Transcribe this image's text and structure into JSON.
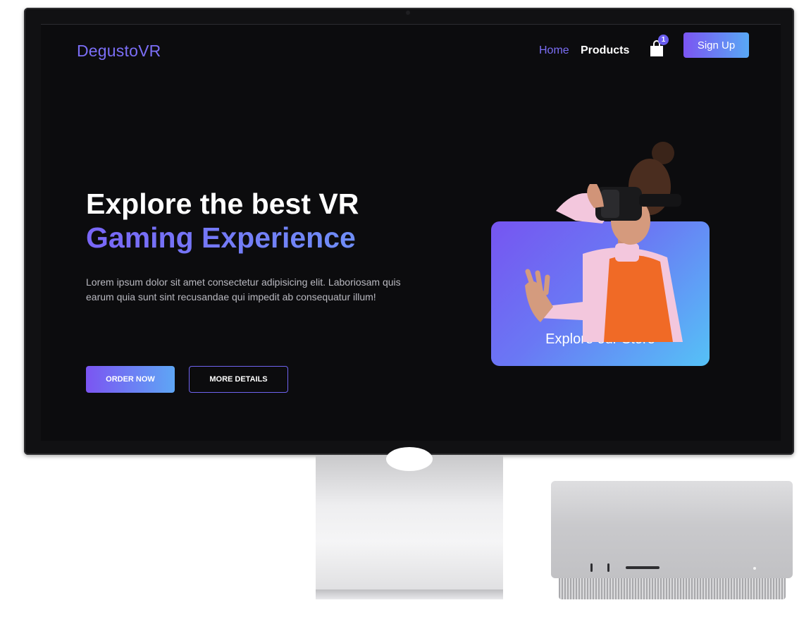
{
  "nav": {
    "brand": "DegustoVR",
    "links": [
      {
        "label": "Home",
        "active": true
      },
      {
        "label": "Products",
        "active": false
      }
    ],
    "cart_count": "1",
    "signup_label": "Sign Up",
    "cart_icon": "shopping-bag-icon"
  },
  "hero": {
    "title_line1": "Explore the best VR",
    "title_line2": "Gaming Experience",
    "description": "Lorem ipsum dolor sit amet consectetur adipisicing elit. Laboriosam quis earum quia sunt sint recusandae qui impedit ab consequatur illum!",
    "order_button": "ORDER NOW",
    "details_button": "MORE DETAILS"
  },
  "store_card": {
    "label": "Explore our Store"
  },
  "colors": {
    "accent": "#7b6ef6",
    "background": "#0c0c0e",
    "gradient_start": "#7655f1",
    "gradient_end": "#55c2f7"
  }
}
